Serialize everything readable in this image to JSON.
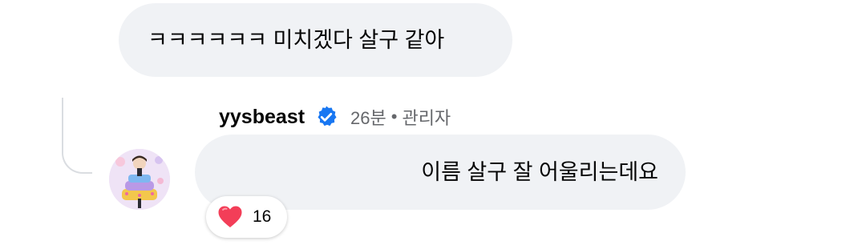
{
  "parent_comment": {
    "text": "ㅋㅋㅋㅋㅋㅋ 미치겠다 살구 같아"
  },
  "reply": {
    "author": "yysbeast",
    "verified_icon": "verified-badge-icon",
    "time": "26분",
    "separator": "•",
    "role": "관리자",
    "text": "이름 살구 잘 어울리는데요",
    "reaction": {
      "icon": "heart-icon",
      "count": "16"
    }
  },
  "colors": {
    "bubble": "#f0f2f5",
    "verified": "#1877f2",
    "heart": "#f33e58",
    "meta_text": "#65676b",
    "thread_line": "#dadde1"
  }
}
